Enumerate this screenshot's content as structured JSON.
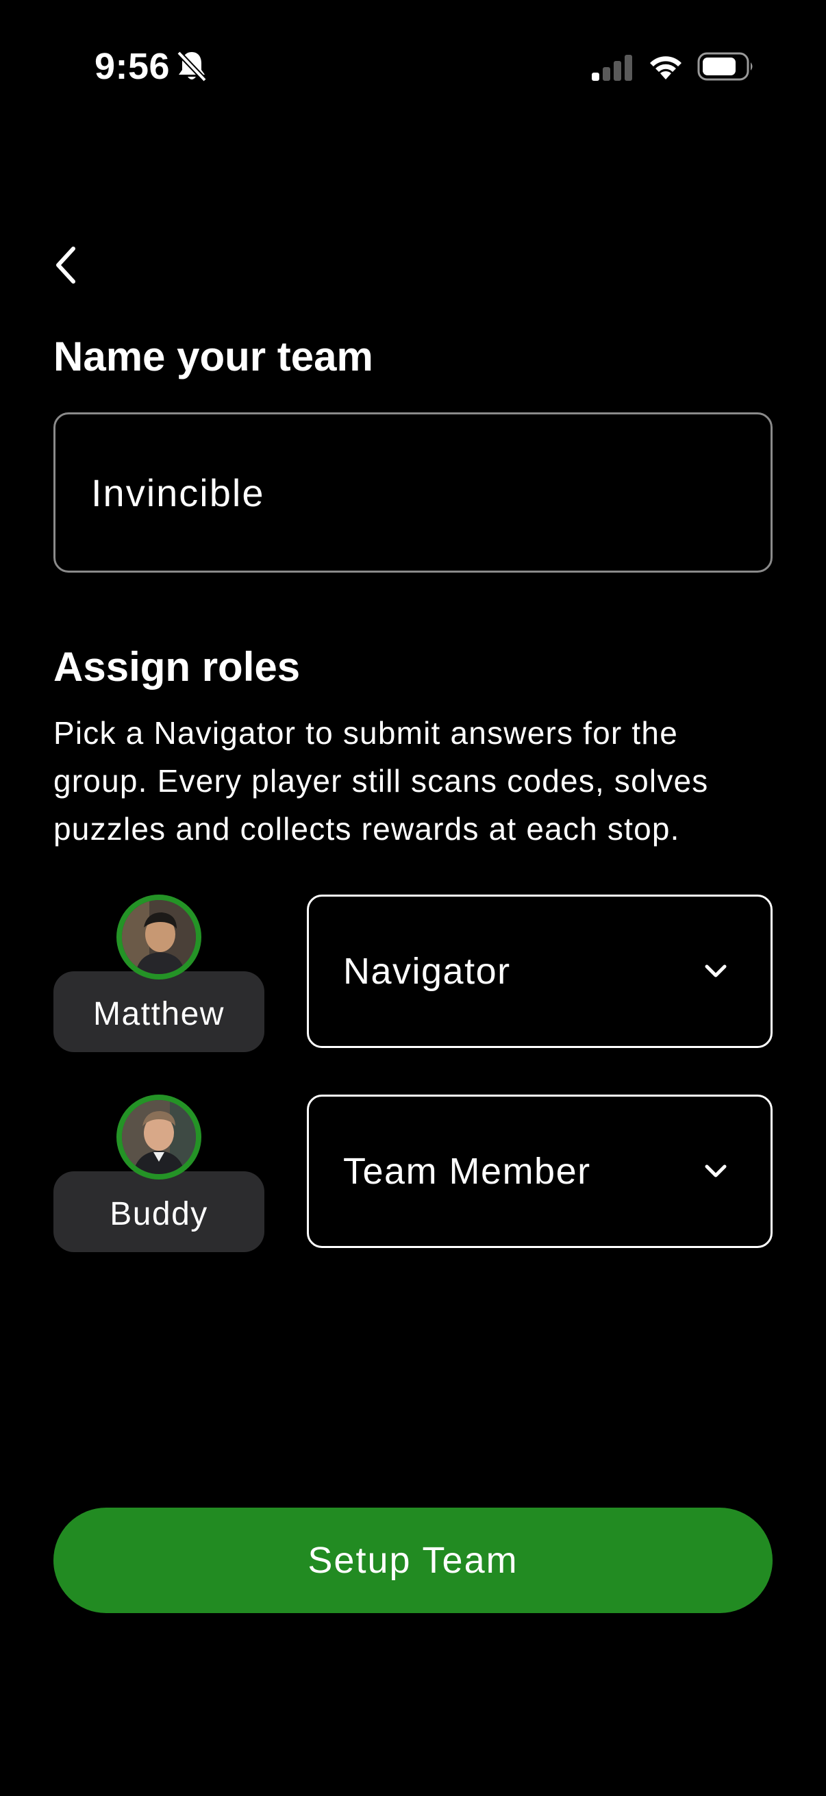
{
  "status_bar": {
    "time": "9:56",
    "icons": [
      "bell-slash-icon",
      "signal-icon",
      "wifi-icon",
      "battery-icon"
    ]
  },
  "navigation": {
    "back_icon": "chevron-left-icon"
  },
  "team_section": {
    "title": "Name your team",
    "team_name_value": "Invincible"
  },
  "roles_section": {
    "title": "Assign roles",
    "description": "Pick a Navigator to submit answers for the group. Every player still scans codes, solves puzzles and collects rewards at each stop.",
    "players": [
      {
        "name": "Matthew",
        "role": "Navigator"
      },
      {
        "name": "Buddy",
        "role": "Team Member"
      }
    ]
  },
  "actions": {
    "setup_label": "Setup Team"
  },
  "colors": {
    "background": "#000000",
    "accent_green": "#228b22",
    "avatar_ring": "#249326",
    "chip_bg": "#2c2c2e"
  }
}
